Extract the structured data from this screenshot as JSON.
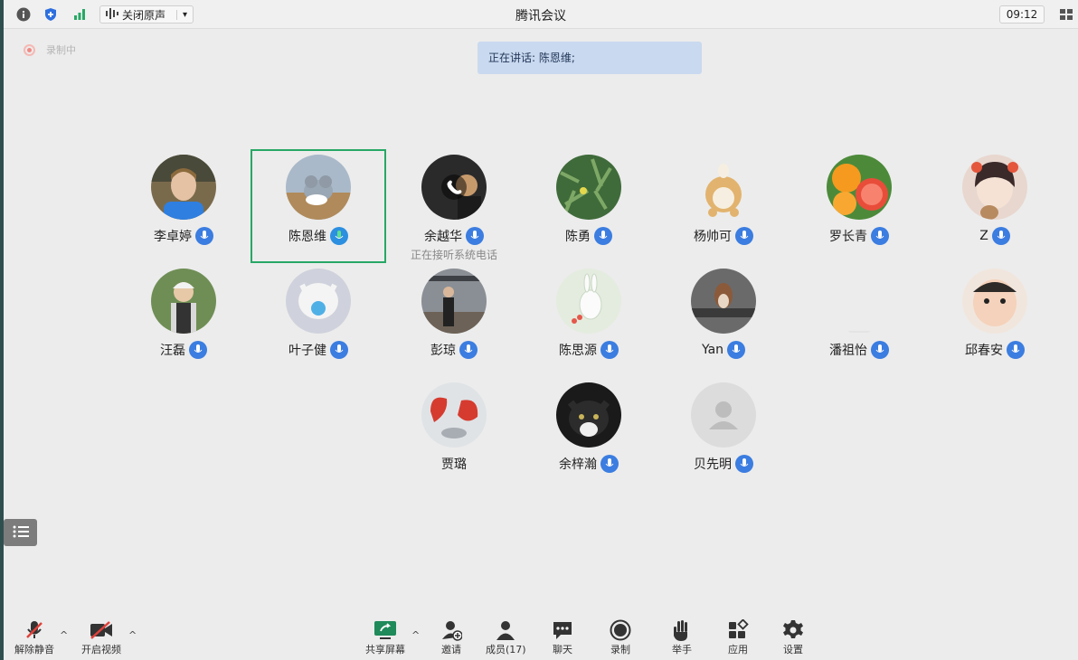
{
  "window": {
    "title": "腾讯会议",
    "time": "09:12"
  },
  "topbar": {
    "audio_label": "关闭原声",
    "audio_dropdown": "▾"
  },
  "recording": {
    "label": "录制中"
  },
  "speaking": {
    "label": "正在讲话: 陈恩维;"
  },
  "participants": [
    {
      "name": "李卓婷",
      "mic": "on"
    },
    {
      "name": "陈恩维",
      "mic": "speaking",
      "active": true
    },
    {
      "name": "余越华",
      "mic": "on",
      "note": "正在接听系统电话"
    },
    {
      "name": "陈勇",
      "mic": "on"
    },
    {
      "name": "杨帅可",
      "mic": "on"
    },
    {
      "name": "罗长青",
      "mic": "on"
    },
    {
      "name": "Z",
      "mic": "on"
    },
    {
      "name": "汪磊",
      "mic": "on"
    },
    {
      "name": "叶子健",
      "mic": "on"
    },
    {
      "name": "彭琼",
      "mic": "on"
    },
    {
      "name": "陈思源",
      "mic": "on"
    },
    {
      "name": "Yan",
      "mic": "on"
    },
    {
      "name": "潘祖怡",
      "mic": "on"
    },
    {
      "name": "邱春安",
      "mic": "on"
    },
    {
      "name": "贾璐",
      "mic": "none"
    },
    {
      "name": "余梓瀚",
      "mic": "on"
    },
    {
      "name": "贝先明",
      "mic": "on"
    }
  ],
  "toolbar": {
    "unmute": "解除静音",
    "start_video": "开启视频",
    "share_screen": "共享屏幕",
    "invite": "邀请",
    "members": "成员(17)",
    "chat": "聊天",
    "record": "录制",
    "raise_hand": "举手",
    "apps": "应用",
    "settings": "设置",
    "caret": "^"
  },
  "colors": {
    "accent": "#3b7de0",
    "active_border": "#27a865",
    "speaking_bg": "#c9d9ef"
  }
}
